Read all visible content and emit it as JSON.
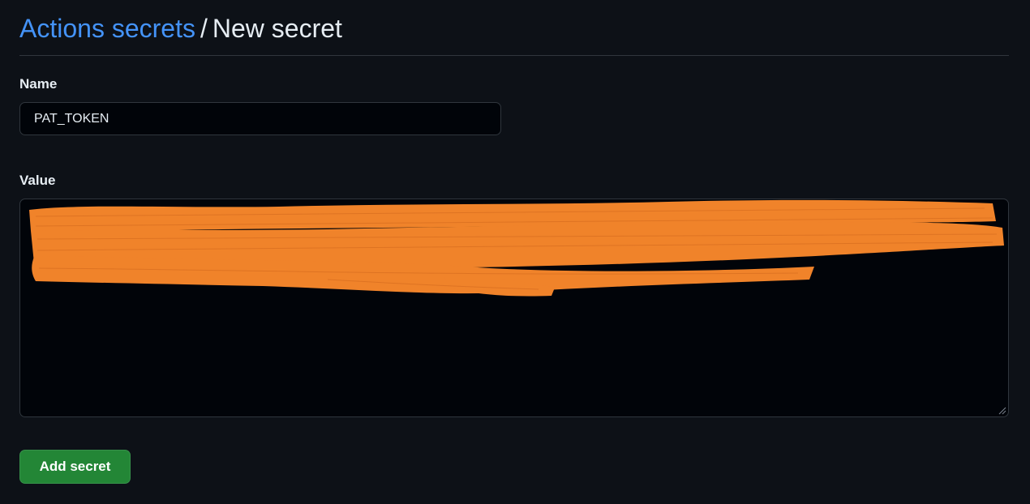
{
  "breadcrumb": {
    "parent": "Actions secrets",
    "separator": "/",
    "current": "New secret"
  },
  "form": {
    "name_label": "Name",
    "name_value": "PAT_TOKEN",
    "value_label": "Value",
    "value_content": "",
    "submit_label": "Add secret"
  },
  "colors": {
    "background": "#0d1117",
    "link": "#4493f8",
    "input_background": "#010409",
    "border": "#30363d",
    "button": "#238636",
    "redaction": "#f0832a"
  },
  "icons": {
    "resize_handle": "resize-grip-icon"
  }
}
